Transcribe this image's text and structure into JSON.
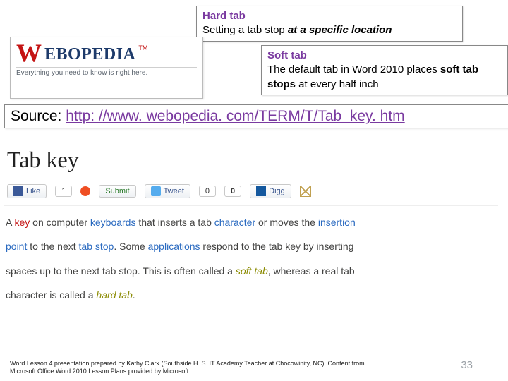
{
  "hard": {
    "title": "Hard tab",
    "line_pre": "Setting a tab stop ",
    "line_em": "at a specific location"
  },
  "soft": {
    "title": "Soft tab",
    "line_pre": "The default tab in Word 2010 places ",
    "line_strong": "soft tab stops",
    "line_post": " at every half inch"
  },
  "logo": {
    "w": "W",
    "rest": "EBOPEDIA",
    "tm": "TM",
    "tagline": "Everything you need to know is right here."
  },
  "source": {
    "label": "Source: ",
    "url_text": "http: //www. webopedia. com/TERM/T/Tab_key. htm"
  },
  "tabkey": {
    "heading": "Tab key"
  },
  "share": {
    "like": "Like",
    "like_count": "1",
    "submit": "Submit",
    "tweet": "Tweet",
    "tweet_count": "0",
    "digg_count": "0",
    "digg": "Digg"
  },
  "def": {
    "p1a": "A ",
    "p1b": "key",
    "p1c": " on computer ",
    "p1d": "keyboards",
    "p1e": " that inserts a tab ",
    "p1f": "character",
    "p1g": " or moves the ",
    "p1h": "insertion",
    "p2a": "point",
    "p2b": " to the next ",
    "p2c": "tab stop",
    "p2d": ". Some ",
    "p2e": "applications",
    "p2f": " respond to the tab key by inserting",
    "p3a": "spaces up to the next tab stop. This is often called a ",
    "p3b": "soft tab",
    "p3c": ", whereas a real tab",
    "p4a": "character is called a ",
    "p4b": "hard tab",
    "p4c": "."
  },
  "footer": {
    "text": "Word Lesson 4 presentation prepared by Kathy Clark (Southside H. S. IT Academy Teacher at Chocowinity, NC). Content from Microsoft Office Word 2010 Lesson Plans provided by Microsoft."
  },
  "slide_number": "33"
}
